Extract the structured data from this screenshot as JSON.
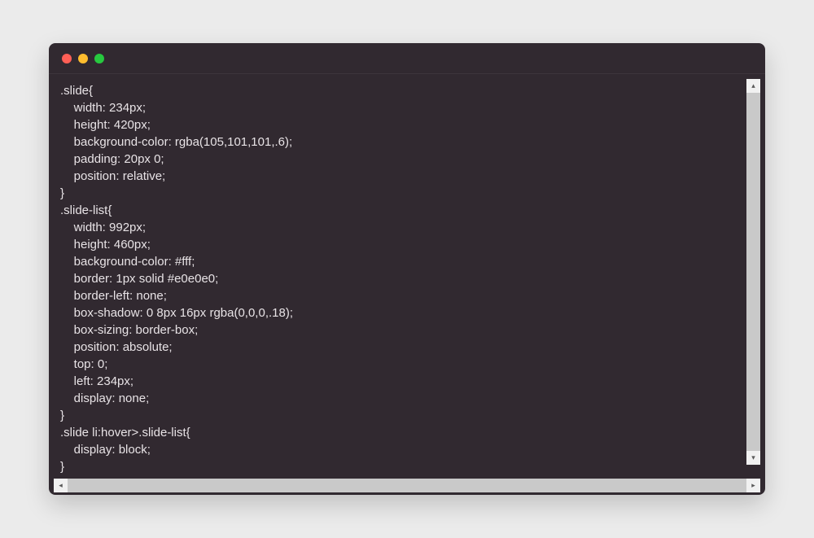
{
  "window": {
    "traffic_lights": {
      "close": "close",
      "minimize": "minimize",
      "maximize": "maximize"
    }
  },
  "code": {
    "lines": [
      ".slide{",
      "    width: 234px;",
      "    height: 420px;",
      "    background-color: rgba(105,101,101,.6);",
      "    padding: 20px 0;",
      "    position: relative;",
      "}",
      ".slide-list{",
      "    width: 992px;",
      "    height: 460px;",
      "    background-color: #fff;",
      "    border: 1px solid #e0e0e0;",
      "    border-left: none;",
      "    box-shadow: 0 8px 16px rgba(0,0,0,.18);",
      "    box-sizing: border-box;",
      "    position: absolute;",
      "    top: 0;",
      "    left: 234px;",
      "    display: none;",
      "}",
      ".slide li:hover>.slide-list{",
      "    display: block;",
      "}"
    ]
  },
  "scrollbar": {
    "up_glyph": "▴",
    "down_glyph": "▾",
    "left_glyph": "◂",
    "right_glyph": "▸"
  }
}
